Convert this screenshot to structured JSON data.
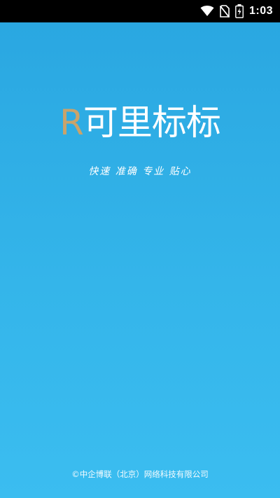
{
  "status_bar": {
    "time": "1:03",
    "icons": [
      "wifi-icon",
      "no-sim-icon",
      "battery-charging-icon"
    ]
  },
  "splash": {
    "logo": {
      "accent_char": "R",
      "text": "可里标标",
      "accent_color": "#c9a36b"
    },
    "slogan": "快速 准确 专业 贴心",
    "copyright": "©中企博联（北京）网络科技有限公司",
    "background_color": "#2aa7e1"
  }
}
